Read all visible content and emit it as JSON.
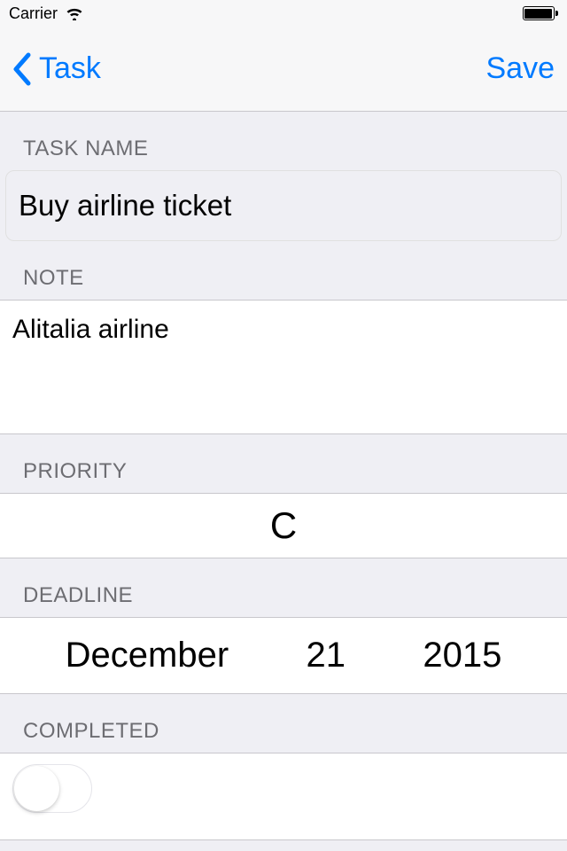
{
  "statusBar": {
    "carrier": "Carrier"
  },
  "nav": {
    "back": "Task",
    "save": "Save"
  },
  "sections": {
    "taskName": {
      "header": "TASK NAME",
      "value": "Buy airline ticket"
    },
    "note": {
      "header": "NOTE",
      "value": "Alitalia airline"
    },
    "priority": {
      "header": "PRIORITY",
      "value": "C"
    },
    "deadline": {
      "header": "DEADLINE",
      "month": "December",
      "day": "21",
      "year": "2015"
    },
    "completed": {
      "header": "COMPLETED",
      "value": false
    }
  }
}
